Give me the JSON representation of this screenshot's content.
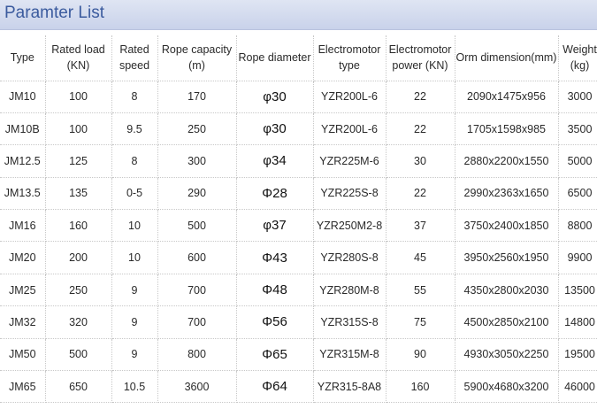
{
  "title": "Paramter List",
  "columns": [
    "Type",
    "Rated load (KN)",
    "Rated speed",
    "Rope capacity (m)",
    "Rope diameter",
    "Electromotor type",
    "Electromotor power (KN)",
    "Orm dimension(mm)",
    "Weight (kg)"
  ],
  "rows": [
    [
      "JM10",
      "100",
      "8",
      "170",
      "φ30",
      "YZR200L-6",
      "22",
      "2090x1475x956",
      "3000"
    ],
    [
      "JM10B",
      "100",
      "9.5",
      "250",
      "φ30",
      "YZR200L-6",
      "22",
      "1705x1598x985",
      "3500"
    ],
    [
      "JM12.5",
      "125",
      "8",
      "300",
      "φ34",
      "YZR225M-6",
      "30",
      "2880x2200x1550",
      "5000"
    ],
    [
      "JM13.5",
      "135",
      "0-5",
      "290",
      "Φ28",
      "YZR225S-8",
      "22",
      "2990x2363x1650",
      "6500"
    ],
    [
      "JM16",
      "160",
      "10",
      "500",
      "φ37",
      "YZR250M2-8",
      "37",
      "3750x2400x1850",
      "8800"
    ],
    [
      "JM20",
      "200",
      "10",
      "600",
      "Φ43",
      "YZR280S-8",
      "45",
      "3950x2560x1950",
      "9900"
    ],
    [
      "JM25",
      "250",
      "9",
      "700",
      "Φ48",
      "YZR280M-8",
      "55",
      "4350x2800x2030",
      "13500"
    ],
    [
      "JM32",
      "320",
      "9",
      "700",
      "Φ56",
      "YZR315S-8",
      "75",
      "4500x2850x2100",
      "14800"
    ],
    [
      "JM50",
      "500",
      "9",
      "800",
      "Φ65",
      "YZR315M-8",
      "90",
      "4930x3050x2250",
      "19500"
    ],
    [
      "JM65",
      "650",
      "10.5",
      "3600",
      "Φ64",
      "YZR315-8A8",
      "160",
      "5900x4680x3200",
      "46000"
    ]
  ]
}
